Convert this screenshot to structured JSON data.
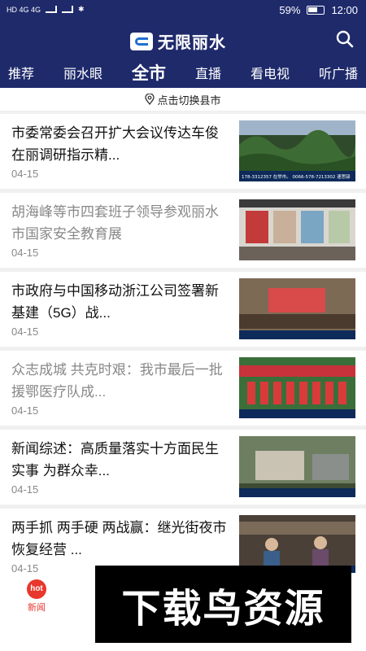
{
  "status_bar": {
    "left": "HD 4G 4G",
    "battery": "59%",
    "time": "12:00"
  },
  "header": {
    "logo_text": "无限丽水"
  },
  "tabs": [
    {
      "label": "推荐",
      "active": false
    },
    {
      "label": "丽水眼",
      "active": false
    },
    {
      "label": "全市",
      "active": true
    },
    {
      "label": "直播",
      "active": false
    },
    {
      "label": "看电视",
      "active": false
    },
    {
      "label": "听广播",
      "active": false
    }
  ],
  "location_bar": {
    "label": "点击切换县市"
  },
  "articles": [
    {
      "title": "市委常委会召开扩大会议传达车俊在丽调研指示精...",
      "date": "04-15",
      "read": false,
      "thumb_caption": "178-3312357 在举市。 0066-578-7213302 速思驿"
    },
    {
      "title": "胡海峰等市四套班子领导参观丽水市国家安全教育展",
      "date": "04-15",
      "read": true,
      "thumb_caption": ""
    },
    {
      "title": "市政府与中国移动浙江公司签署新基建（5G）战...",
      "date": "04-15",
      "read": false,
      "thumb_caption": ""
    },
    {
      "title": "众志成城 共克时艰：我市最后一批援鄂医疗队成...",
      "date": "04-15",
      "read": true,
      "thumb_caption": ""
    },
    {
      "title": "新闻综述：高质量落实十方面民生实事 为群众幸...",
      "date": "04-15",
      "read": false,
      "thumb_caption": ""
    },
    {
      "title": "两手抓 两手硬 两战赢：继光街夜市恢复经营 ...",
      "date": "04-15",
      "read": false,
      "thumb_caption": ""
    }
  ],
  "bottom_nav": {
    "news_badge": "hot",
    "news_label": "新闻"
  },
  "watermark": {
    "text": "下载鸟资源"
  },
  "colors": {
    "brand_dark": "#1f2a6b",
    "accent_red": "#e8372c"
  }
}
